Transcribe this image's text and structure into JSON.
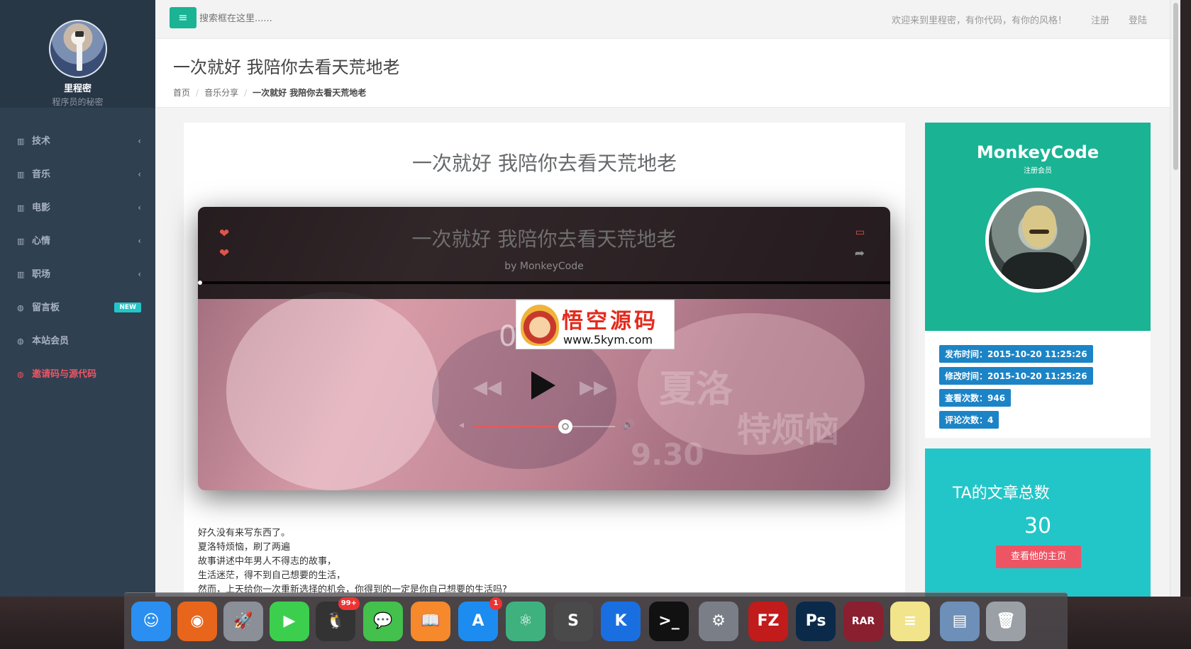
{
  "sidebar": {
    "name": "里程密",
    "subtitle": "程序员的秘密",
    "items": [
      {
        "label": "技术",
        "icon": "bar-chart-icon"
      },
      {
        "label": "音乐",
        "icon": "bar-chart-icon"
      },
      {
        "label": "电影",
        "icon": "bar-chart-icon"
      },
      {
        "label": "心情",
        "icon": "bar-chart-icon"
      },
      {
        "label": "职场",
        "icon": "bar-chart-icon"
      },
      {
        "label": "留言板",
        "icon": "globe-icon",
        "badge": "NEW"
      },
      {
        "label": "本站会员",
        "icon": "globe-icon"
      },
      {
        "label": "邀请码与源代码",
        "icon": "globe-icon"
      }
    ]
  },
  "topbar": {
    "search_placeholder": "搜索框在这里......",
    "welcome": "欢迎来到里程密，有你代码，有你的风格！",
    "register": "注册",
    "login": "登陆"
  },
  "header": {
    "title": "一次就好 我陪你去看天荒地老",
    "breadcrumb": [
      "首页",
      "音乐分享",
      "一次就好 我陪你去看天荒地老"
    ]
  },
  "article": {
    "title": "一次就好 我陪你去看天荒地老",
    "player": {
      "title": "一次就好 我陪你去看天荒地老",
      "by": "by MonkeyCode",
      "time": "0",
      "volume": 0.65
    },
    "poster_text": [
      "夏洛",
      "特烦恼",
      "9.30"
    ],
    "lines": [
      "好久没有来写东西了。",
      "夏洛特烦恼，刷了两遍",
      "故事讲述中年男人不得志的故事，",
      "生活迷茫，得不到自己想要的生活，",
      "然而，上天给你一次重新选择的机会，你得到的一定是你自己想要的生活吗?"
    ]
  },
  "watermark": {
    "title": "悟空源码",
    "url": "www.5kym.com"
  },
  "author": {
    "name": "MonkeyCode",
    "role": "注册会员",
    "stats": [
      "发布时间：2015-10-20 11:25:26",
      "修改时间：2015-10-20 11:25:26",
      "查看次数：946",
      "评论次数：4"
    ],
    "total_label": "TA的文章总数",
    "total": "30",
    "home_button": "查看他的主页"
  },
  "dock": {
    "apps": [
      {
        "name": "finder",
        "glyph": "☺",
        "color": "#2a8ff0"
      },
      {
        "name": "firefox",
        "glyph": "◉",
        "color": "#e8661c"
      },
      {
        "name": "launchpad",
        "glyph": "🚀",
        "color": "#8a8f98"
      },
      {
        "name": "facetime",
        "glyph": "▶",
        "color": "#3ccf4e"
      },
      {
        "name": "qq",
        "glyph": "🐧",
        "color": "#333333",
        "badge": "99+"
      },
      {
        "name": "wechat",
        "glyph": "💬",
        "color": "#44c04d"
      },
      {
        "name": "ibooks",
        "glyph": "📖",
        "color": "#f5892b"
      },
      {
        "name": "app-store",
        "glyph": "A",
        "color": "#1d8cf0",
        "badge": "1"
      },
      {
        "name": "atom",
        "glyph": "⚛",
        "color": "#3fb17f"
      },
      {
        "name": "sublime-text",
        "glyph": "S",
        "color": "#4a4a4a"
      },
      {
        "name": "kugou",
        "glyph": "K",
        "color": "#1a6fe0"
      },
      {
        "name": "terminal",
        "glyph": ">_",
        "color": "#111111"
      },
      {
        "name": "system-preferences",
        "glyph": "⚙",
        "color": "#7a7f87"
      },
      {
        "name": "filezilla",
        "glyph": "FZ",
        "color": "#c21b1b"
      },
      {
        "name": "photoshop",
        "glyph": "Ps",
        "color": "#0b2a4a"
      },
      {
        "name": "rar-extractor",
        "glyph": "RAR",
        "color": "#8a1f2f"
      },
      {
        "name": "notes",
        "glyph": "≡",
        "color": "#f1e48a"
      },
      {
        "name": "documents-folder",
        "glyph": "▤",
        "color": "#6d8fb8"
      },
      {
        "name": "trash",
        "glyph": "🗑",
        "color": "#9aa0a6"
      }
    ]
  }
}
